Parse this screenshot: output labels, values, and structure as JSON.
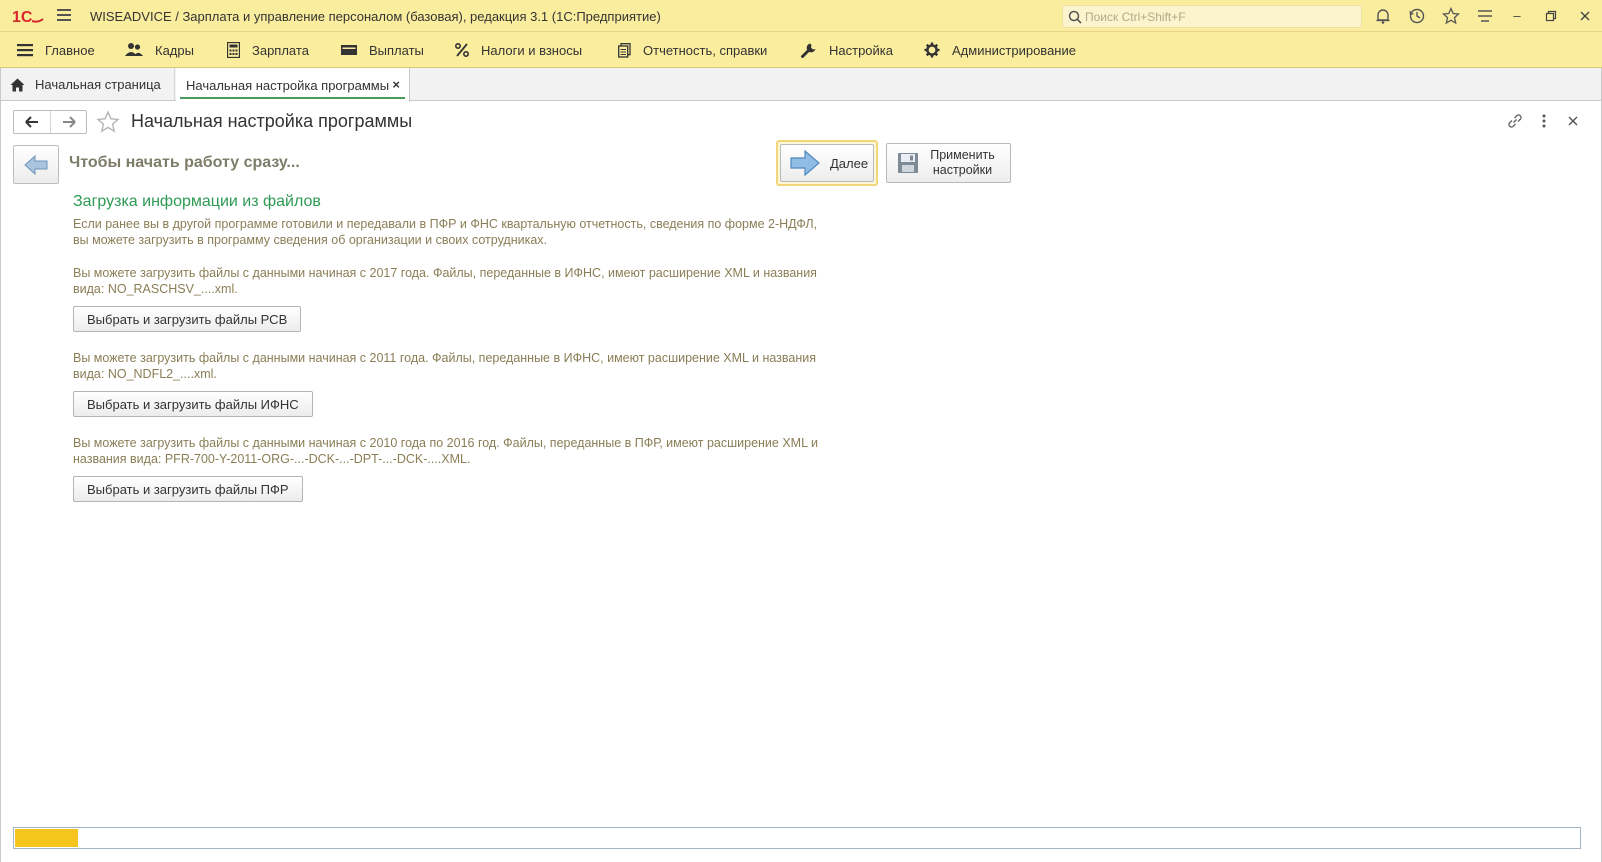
{
  "window": {
    "title": "WISEADVICE / Зарплата и управление персоналом (базовая), редакция 3.1  (1С:Предприятие)",
    "logo_text": "1С",
    "search_placeholder": "Поиск Ctrl+Shift+F"
  },
  "sections": [
    {
      "label": "Главное",
      "icon": "menu-icon"
    },
    {
      "label": "Кадры",
      "icon": "people-icon"
    },
    {
      "label": "Зарплата",
      "icon": "calculator-icon"
    },
    {
      "label": "Выплаты",
      "icon": "wallet-icon"
    },
    {
      "label": "Налоги и взносы",
      "icon": "percent-icon"
    },
    {
      "label": "Отчетность, справки",
      "icon": "reports-icon"
    },
    {
      "label": "Настройка",
      "icon": "wrench-icon"
    },
    {
      "label": "Администрирование",
      "icon": "gear-icon"
    }
  ],
  "tabs": {
    "home": "Начальная страница",
    "active": "Начальная настройка программы"
  },
  "form": {
    "title": "Начальная настройка программы",
    "step_title": "Чтобы начать работу сразу...",
    "next_label": "Далее",
    "apply_label_line1": "Применить",
    "apply_label_line2": "настройки"
  },
  "content": {
    "section_title": "Загрузка информации из файлов",
    "intro": "Если ранее вы в другой программе готовили и передавали в ПФР и ФНС квартальную отчетность, сведения по форме 2-НДФЛ, вы можете загрузить в программу сведения об организации и своих сотрудниках.",
    "rsv_text": "Вы можете загрузить файлы с данными начиная с 2017 года. Файлы, переданные в ИФНС, имеют расширение XML и названия вида: NO_RASCHSV_....xml.",
    "rsv_button": "Выбрать и загрузить файлы РСВ",
    "ifns_text": "Вы можете загрузить файлы с данными начиная с 2011 года. Файлы, переданные в ИФНС, имеют расширение XML и названия вида: NO_NDFL2_....xml.",
    "ifns_button": "Выбрать и загрузить файлы ИФНС",
    "pfr_text": "Вы можете загрузить файлы с данными начиная с 2010 года по 2016 год. Файлы, переданные в ПФР, имеют расширение XML и названия вида: PFR-700-Y-2011-ORG-...-DCK-...-DPT-...-DCK-....XML.",
    "pfr_button": "Выбрать и загрузить файлы ПФР"
  },
  "progress": {
    "value_fraction": 0.04
  },
  "colors": {
    "titlebar": "#fbed9e",
    "accent_green": "#2e9a55",
    "progress_fill": "#f6c51d",
    "hint_text": "#8a7e56"
  }
}
